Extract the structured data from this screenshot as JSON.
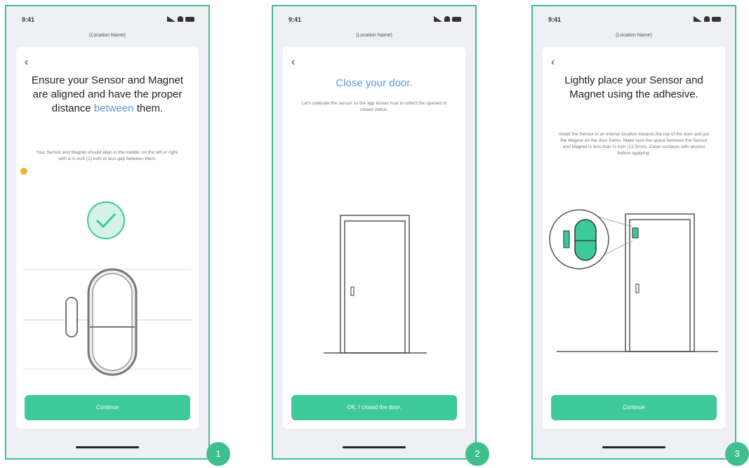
{
  "phones": [
    {
      "status_time": "9:41",
      "location": "(Location Name)",
      "title_part1": "Ensure your Sensor and Magnet are aligned and have the proper distance ",
      "title_highlight": "between",
      "title_part2": " them.",
      "subtitle": "Your Sensor and Magnet should align in the middle, on the left or right, with a ½ inch (1) inch or less gap between them.",
      "button_label": "Continue",
      "step": "1"
    },
    {
      "status_time": "9:41",
      "location": "(Location Name)",
      "title": "Close your door.",
      "subtitle": "Let's calibrate the sensor so the app knows how to reflect the opened or closed status.",
      "button_label": "OK, I closed the door.",
      "step": "2"
    },
    {
      "status_time": "9:41",
      "location": "(Location Name)",
      "title": "Lightly place your Sensor and Magnet using the adhesive.",
      "subtitle": "Install the Sensor in an interior location towards the top of the door and put the Magnet on the door frame. Make sure the space between the Sensor and Magnet is less than ½ inch (12.5mm). Clean surfaces with alcohol before applying.",
      "button_label": "Continue",
      "step": "3"
    }
  ],
  "colors": {
    "accent": "#3dc99a",
    "border": "#3fbf8f",
    "link": "#5b9ad9"
  },
  "icons": [
    "back-arrow-icon",
    "check-icon",
    "signal-icon",
    "wifi-icon",
    "battery-icon"
  ]
}
